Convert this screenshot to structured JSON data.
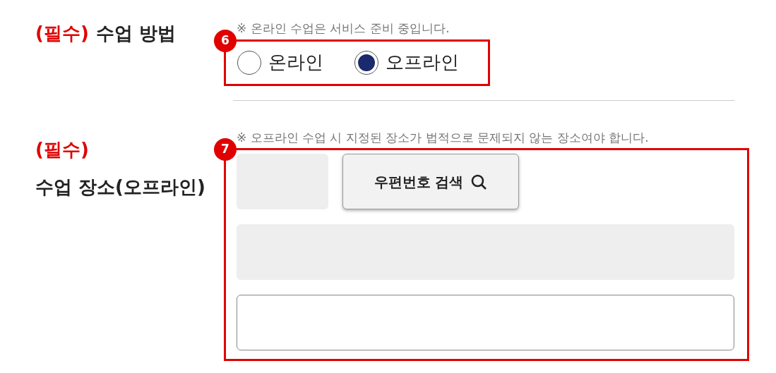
{
  "method": {
    "required": "(필수)",
    "label": "수업 방법",
    "note": "※ 온라인 수업은 서비스 준비 중입니다.",
    "marker": "6",
    "options": [
      {
        "label": "온라인",
        "selected": false
      },
      {
        "label": "오프라인",
        "selected": true
      }
    ]
  },
  "place": {
    "required": "(필수)",
    "label": "수업 장소(오프라인)",
    "note": "※ 오프라인 수업 시 지정된 장소가 법적으로 문제되지 않는 장소여야 합니다.",
    "marker": "7",
    "search_button": "우편번호 검색"
  }
}
